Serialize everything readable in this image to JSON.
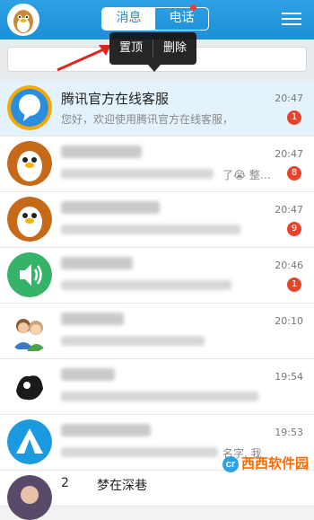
{
  "header": {
    "tabs": [
      {
        "label": "消息",
        "active": true
      },
      {
        "label": "电话",
        "active": false
      }
    ],
    "tab_dot_color": "#ff3b30",
    "menu_icon": "hamburger-menu-icon"
  },
  "popup": {
    "items": [
      {
        "label": "置顶"
      },
      {
        "label": "删除"
      }
    ]
  },
  "conversations": [
    {
      "name": "腾讯官方在线客服",
      "message": "您好，欢迎使用腾讯官方在线客服，",
      "time": "20:47",
      "badge": "1",
      "avatar": "tencent-service-avatar",
      "highlight": true
    },
    {
      "name": "",
      "message_tail": "了😭 整…",
      "time": "20:47",
      "badge": "8",
      "avatar": "penguin-avatar"
    },
    {
      "name": "",
      "time": "20:47",
      "badge": "9",
      "avatar": "penguin-avatar"
    },
    {
      "name": "",
      "time": "20:46",
      "badge": "1",
      "avatar": "speaker-avatar"
    },
    {
      "name": "",
      "time": "20:10",
      "badge": "",
      "avatar": "couple-avatar"
    },
    {
      "name": "",
      "time": "19:54",
      "badge": "",
      "avatar": "inkblot-avatar"
    },
    {
      "name": "",
      "message_tail": "名字, 我",
      "time": "19:53",
      "badge": "",
      "avatar": "tent-avatar"
    },
    {
      "name_num": "2",
      "name": "梦在深巷",
      "time": "",
      "badge": "",
      "avatar": "girl-avatar"
    }
  ],
  "watermark": {
    "text": "西西软件园",
    "logo": "cr"
  },
  "colors": {
    "header": "#1c8fd8",
    "badge": "#e8442c",
    "highlight_row": "#e4f3fb"
  }
}
